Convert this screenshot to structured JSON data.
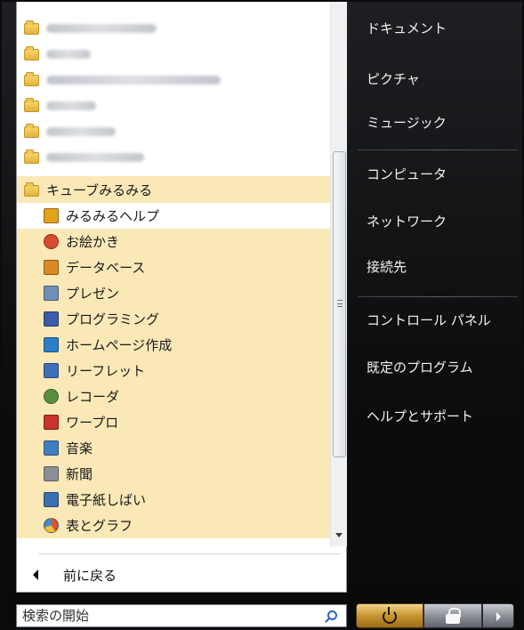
{
  "programs": {
    "blurred_folders": [
      {
        "width": 124
      },
      {
        "width": 50
      },
      {
        "width": 196
      },
      {
        "width": 56
      },
      {
        "width": 78
      },
      {
        "width": 110
      }
    ],
    "items": [
      {
        "label": "キューブみるみる",
        "icon": "folder-icon",
        "color": "#e8b840",
        "highlight": true
      },
      {
        "label": "みるみるヘルプ",
        "icon": "help-icon",
        "color": "#e2a21b",
        "selected": true
      },
      {
        "label": "お絵かき",
        "icon": "paint-icon",
        "color": "#d94a2f",
        "highlight": true
      },
      {
        "label": "データベース",
        "icon": "database-icon",
        "color": "#d98a22",
        "highlight": true
      },
      {
        "label": "プレゼン",
        "icon": "presentation-icon",
        "color": "#6f8fb6",
        "highlight": true
      },
      {
        "label": "プログラミング",
        "icon": "programming-icon",
        "color": "#3c5ca8",
        "highlight": true
      },
      {
        "label": "ホームページ作成",
        "icon": "homepage-icon",
        "color": "#2c7ec7",
        "highlight": true
      },
      {
        "label": "リーフレット",
        "icon": "leaflet-icon",
        "color": "#3e6fb8",
        "highlight": true
      },
      {
        "label": "レコーダ",
        "icon": "recorder-icon",
        "color": "#5a8f3e",
        "highlight": true
      },
      {
        "label": "ワープロ",
        "icon": "wordprocessor-icon",
        "color": "#c8332b",
        "highlight": true
      },
      {
        "label": "音楽",
        "icon": "music-icon",
        "color": "#3f7fbf",
        "highlight": true
      },
      {
        "label": "新聞",
        "icon": "newspaper-icon",
        "color": "#8a8f96",
        "highlight": true
      },
      {
        "label": "電子紙しばい",
        "icon": "kamishibai-icon",
        "color": "#3a6fb0",
        "highlight": true
      },
      {
        "label": "表とグラフ",
        "icon": "chart-icon",
        "color": "#d9543a",
        "highlight": true
      }
    ]
  },
  "back": {
    "label": "前に戻る"
  },
  "search": {
    "placeholder": "検索の開始"
  },
  "right_menu": {
    "items": [
      {
        "label": "ドキュメント"
      },
      {
        "label": "ピクチャ"
      },
      {
        "label": "ミュージック"
      },
      {
        "label": "コンピュータ"
      },
      {
        "label": "ネットワーク"
      },
      {
        "label": "接続先"
      },
      {
        "label": "コントロール パネル"
      },
      {
        "label": "既定のプログラム"
      },
      {
        "label": "ヘルプとサポート"
      }
    ]
  },
  "colors": {
    "highlight": "#fbe8b7",
    "power_button": "#c7952f"
  }
}
